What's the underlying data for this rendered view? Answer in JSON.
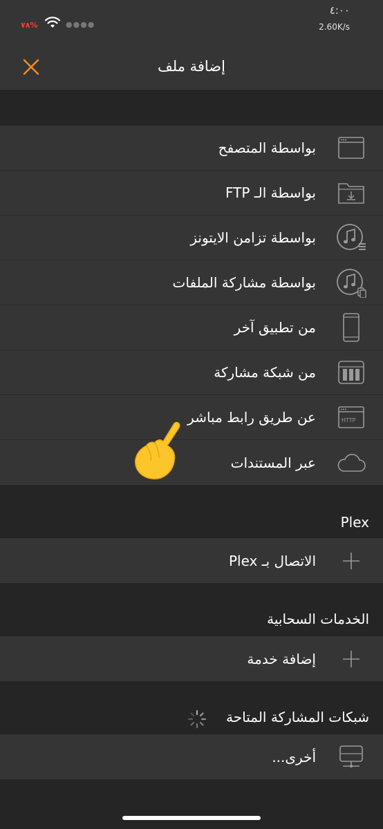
{
  "status_bar": {
    "time": "٤:٠٠",
    "network_speed": "2.60K/s",
    "battery": "٧٨%"
  },
  "nav": {
    "title": "إضافة ملف",
    "close_icon": "close-icon"
  },
  "add_sources": [
    {
      "label": "بواسطة المتصفح",
      "icon": "browser-window-icon"
    },
    {
      "label": "بواسطة الـ FTP",
      "icon": "folder-download-icon"
    },
    {
      "label": "بواسطة تزامن الايتونز",
      "icon": "itunes-sync-icon"
    },
    {
      "label": "بواسطة مشاركة الملفات",
      "icon": "itunes-file-sharing-icon"
    },
    {
      "label": "من تطبيق آخر",
      "icon": "phone-icon"
    },
    {
      "label": "من شبكة مشاركة",
      "icon": "nas-drive-icon"
    },
    {
      "label": "عن طريق رابط مباشر",
      "icon": "http-window-icon"
    },
    {
      "label": "عبر المستندات",
      "icon": "cloud-icon"
    }
  ],
  "plex": {
    "header": "Plex",
    "connect_label": "الاتصال بـ Plex"
  },
  "cloud_services": {
    "header": "الخدمات السحابية",
    "add_label": "إضافة خدمة"
  },
  "shared_networks": {
    "header": "شبكات المشاركة المتاحة",
    "other_label": "أخرى..."
  },
  "colors": {
    "accent": "#f08a24",
    "row_bg": "#353535",
    "gap_bg": "#252525",
    "icon_gray": "#9a9a9a"
  }
}
